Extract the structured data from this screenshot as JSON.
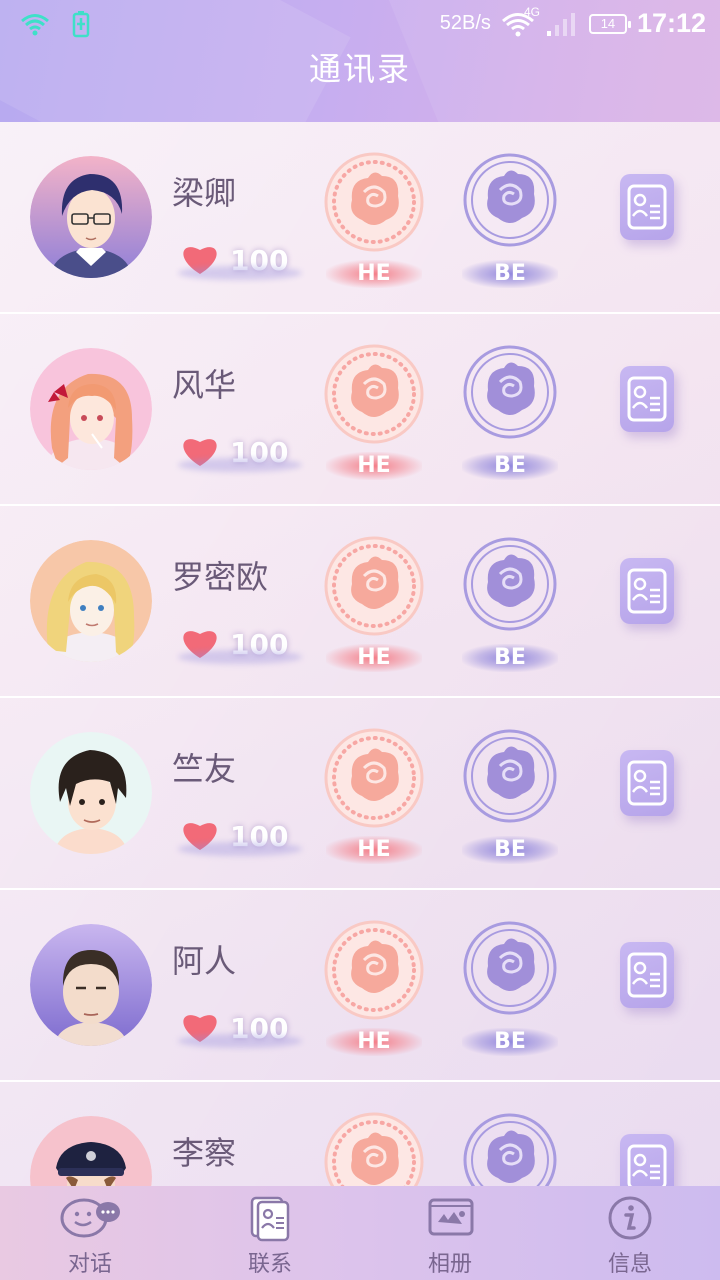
{
  "status_bar": {
    "net_speed": "52B/s",
    "signal_label": "4G",
    "battery": "14",
    "time": "17:12"
  },
  "header": {
    "title": "通讯录"
  },
  "contacts": [
    {
      "name": "梁卿",
      "affinity": "100",
      "he_label": "HE",
      "be_label": "BE"
    },
    {
      "name": "风华",
      "affinity": "100",
      "he_label": "HE",
      "be_label": "BE"
    },
    {
      "name": "罗密欧",
      "affinity": "100",
      "he_label": "HE",
      "be_label": "BE"
    },
    {
      "name": "竺友",
      "affinity": "100",
      "he_label": "HE",
      "be_label": "BE"
    },
    {
      "name": "阿人",
      "affinity": "100",
      "he_label": "HE",
      "be_label": "BE"
    },
    {
      "name": "李察"
    }
  ],
  "bottom_nav": {
    "items": [
      {
        "label": "对话",
        "icon": "chat-bubble-icon"
      },
      {
        "label": "联系",
        "icon": "contact-card-icon"
      },
      {
        "label": "相册",
        "icon": "photo-album-icon"
      },
      {
        "label": "信息",
        "icon": "info-icon"
      }
    ],
    "active_index": 1
  },
  "colors": {
    "header": "#c2acf0",
    "he_accent": "#f47882",
    "be_accent": "#8c82dc",
    "heart": "#f26a78"
  }
}
